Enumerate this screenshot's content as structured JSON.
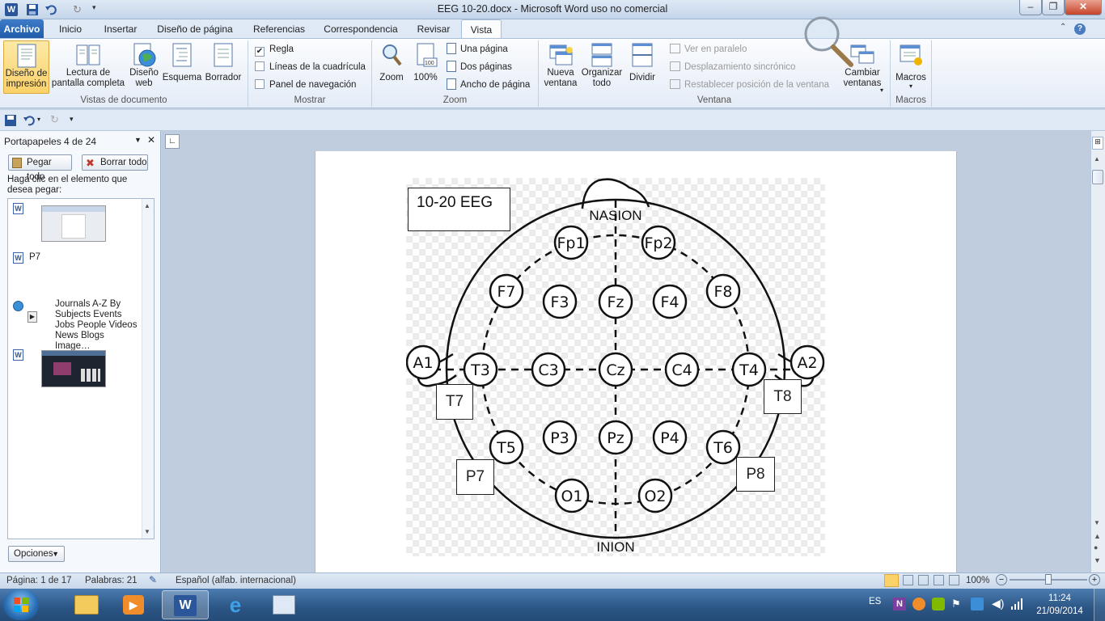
{
  "window": {
    "title": "EEG 10-20.docx - Microsoft Word uso no comercial"
  },
  "menu": {
    "tabs": [
      "Archivo",
      "Inicio",
      "Insertar",
      "Diseño de página",
      "Referencias",
      "Correspondencia",
      "Revisar",
      "Vista"
    ],
    "active": "Vista"
  },
  "ribbon": {
    "vistas": {
      "print": "Diseño de impresión",
      "reading": "Lectura de pantalla completa",
      "web": "Diseño web",
      "outline": "Esquema",
      "draft": "Borrador",
      "group": "Vistas de documento"
    },
    "mostrar": {
      "ruler": "Regla",
      "gridlines": "Líneas de la cuadrícula",
      "navpane": "Panel de navegación",
      "ruler_checked": true,
      "gridlines_checked": false,
      "navpane_checked": false,
      "group": "Mostrar"
    },
    "zoom": {
      "zoom": "Zoom",
      "pct": "100%",
      "one_page": "Una página",
      "two_pages": "Dos páginas",
      "page_width": "Ancho de página",
      "group": "Zoom"
    },
    "ventana": {
      "new_window": "Nueva ventana",
      "arrange_all": "Organizar todo",
      "split": "Dividir",
      "side_by_side": "Ver en paralelo",
      "sync_scroll": "Desplazamiento sincrónico",
      "reset_pos": "Restablecer posición de la ventana",
      "switch": "Cambiar ventanas",
      "group": "Ventana"
    },
    "macros": {
      "macros": "Macros",
      "group": "Macros"
    }
  },
  "clipboard": {
    "title": "Portapapeles 4 de 24",
    "paste_all": "Pegar todo",
    "clear_all": "Borrar todo",
    "hint": "Haga clic en el elemento que desea pegar:",
    "item_p7": "P7",
    "item_web": [
      "Journals A-Z By",
      "Subjects Events",
      "Jobs People Videos",
      "News Blogs Image…"
    ],
    "options": "Opciones"
  },
  "document": {
    "box_title": "10-20 EEG",
    "nasion": "NASION",
    "inion": "INION",
    "electrodes": [
      "Fp1",
      "Fp2",
      "F7",
      "F3",
      "Fz",
      "F4",
      "F8",
      "A1",
      "T3",
      "C3",
      "Cz",
      "C4",
      "T4",
      "A2",
      "T5",
      "P3",
      "Pz",
      "P4",
      "T6",
      "O1",
      "O2"
    ],
    "boxes": [
      "T7",
      "T8",
      "P7",
      "P8"
    ]
  },
  "status": {
    "page": "Página: 1 de 17",
    "words": "Palabras: 21",
    "language": "Español (alfab. internacional)",
    "zoom": "100%"
  },
  "tray": {
    "lang": "ES",
    "time": "11:24",
    "date": "21/09/2014"
  },
  "colors": {
    "accent": "#2b579a",
    "ribbon_bg": "#dfe9f5"
  }
}
